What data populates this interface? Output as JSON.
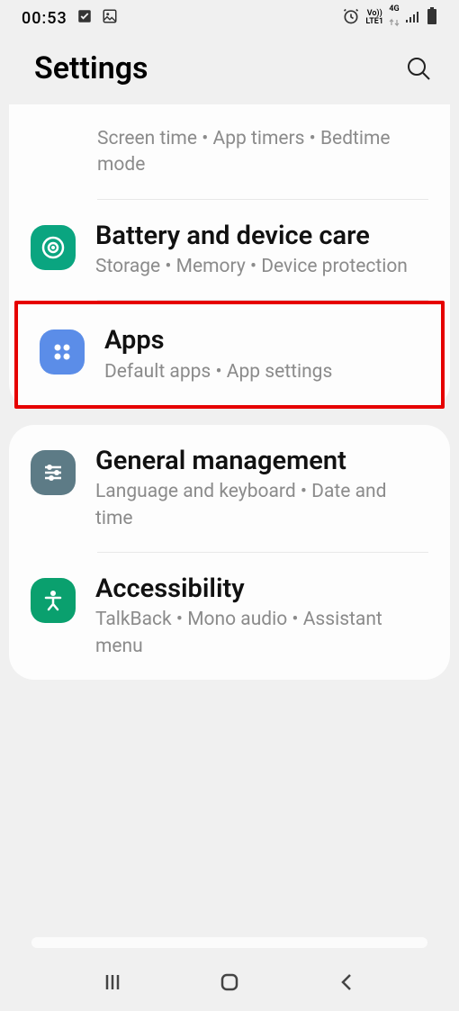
{
  "status": {
    "time": "00:53",
    "network_label_top": "Vo))",
    "network_label_bottom": "LTE1",
    "signal": "4G"
  },
  "header": {
    "title": "Settings"
  },
  "items": {
    "screen_time": {
      "sub": "Screen time  •  App timers  •  Bedtime mode"
    },
    "battery": {
      "title": "Battery and device care",
      "sub": "Storage  •  Memory  •  Device protection"
    },
    "apps": {
      "title": "Apps",
      "sub": "Default apps  •  App settings"
    },
    "general": {
      "title": "General management",
      "sub": "Language and keyboard  •  Date and time"
    },
    "accessibility": {
      "title": "Accessibility",
      "sub": "TalkBack  •  Mono audio  •  Assistant menu"
    }
  }
}
